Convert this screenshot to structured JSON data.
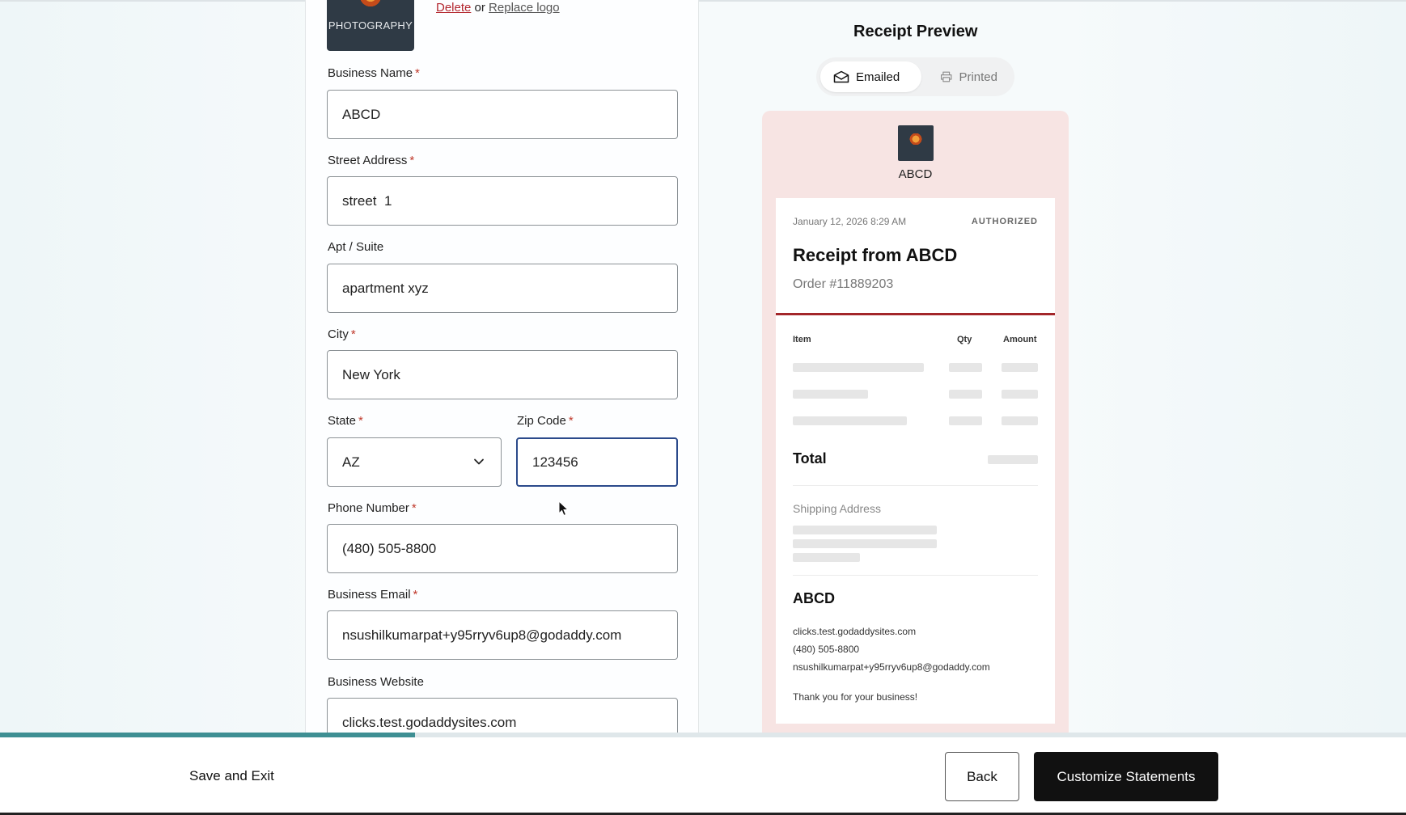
{
  "logo": {
    "text": "PHOTOGRAPHY",
    "delete_label": "Delete",
    "or_text": "or",
    "replace_label": "Replace logo"
  },
  "form": {
    "business_name": {
      "label": "Business Name",
      "value": "ABCD",
      "required": "*"
    },
    "street_address": {
      "label": "Street Address",
      "value": "street  1",
      "required": "*"
    },
    "apt_suite": {
      "label": "Apt / Suite",
      "value": "apartment xyz"
    },
    "city": {
      "label": "City",
      "value": "New York",
      "required": "*"
    },
    "state": {
      "label": "State",
      "value": "AZ",
      "required": "*"
    },
    "zip": {
      "label": "Zip Code",
      "value": "123456",
      "required": "*"
    },
    "phone": {
      "label": "Phone Number",
      "value": "(480) 505-8800",
      "required": "*"
    },
    "email": {
      "label": "Business Email",
      "value": "nsushilkumarpat+y95rryv6up8@godaddy.com",
      "required": "*"
    },
    "website": {
      "label": "Business Website",
      "value": "clicks.test.godaddysites.com"
    }
  },
  "preview": {
    "title": "Receipt Preview",
    "tabs": [
      {
        "label": "Emailed",
        "icon": "envelope-icon",
        "active": true
      },
      {
        "label": "Printed",
        "icon": "printer-icon",
        "active": false
      }
    ],
    "business_name": "ABCD",
    "receipt": {
      "date": "January 12, 2026 8:29 AM",
      "status": "AUTHORIZED",
      "title": "Receipt from ABCD",
      "order": "Order #11889203",
      "columns": [
        "Item",
        "Qty",
        "Amount"
      ],
      "total_label": "Total",
      "shipping_label": "Shipping Address",
      "footer_business": "ABCD",
      "website": "clicks.test.godaddysites.com",
      "phone": "(480) 505-8800",
      "email": "nsushilkumarpat+y95rryv6up8@godaddy.com",
      "thanks": "Thank you for your business!"
    },
    "accent_color": "#a3262a",
    "card_bg": "#f7e4e3"
  },
  "footer": {
    "save_exit": "Save and Exit",
    "back": "Back",
    "primary": "Customize Statements",
    "progress_fraction": 0.295,
    "progress_color": "#3e8f93"
  }
}
